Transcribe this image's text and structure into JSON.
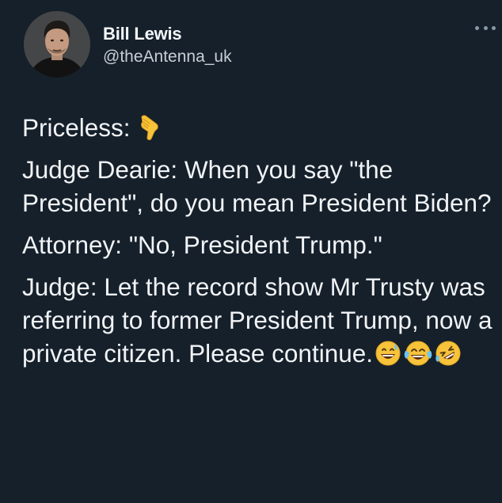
{
  "author": {
    "display_name": "Bill Lewis",
    "handle": "@theAntenna_uk"
  },
  "more_menu": {
    "icon": "more-dots-icon"
  },
  "tweet": {
    "line1_text": "Priceless:",
    "line1_emoji": "backhand-index-pointing-down",
    "para2": "Judge Dearie: When you say \"the President\", do you mean President Biden?",
    "para3": "Attorney: \"No, President Trump.\"",
    "para4": "Judge: Let the record show Mr Trusty was referring to former President Trump, now a private citizen. Please continue.",
    "para4_emojis": [
      "grinning-face-with-sweat",
      "face-with-tears-of-joy",
      "rolling-on-the-floor-laughing"
    ]
  },
  "colors": {
    "background": "#15202b",
    "text": "#f1f3f5",
    "secondary_text": "#c9ced4",
    "emoji_yellow": "#f7c33b"
  }
}
